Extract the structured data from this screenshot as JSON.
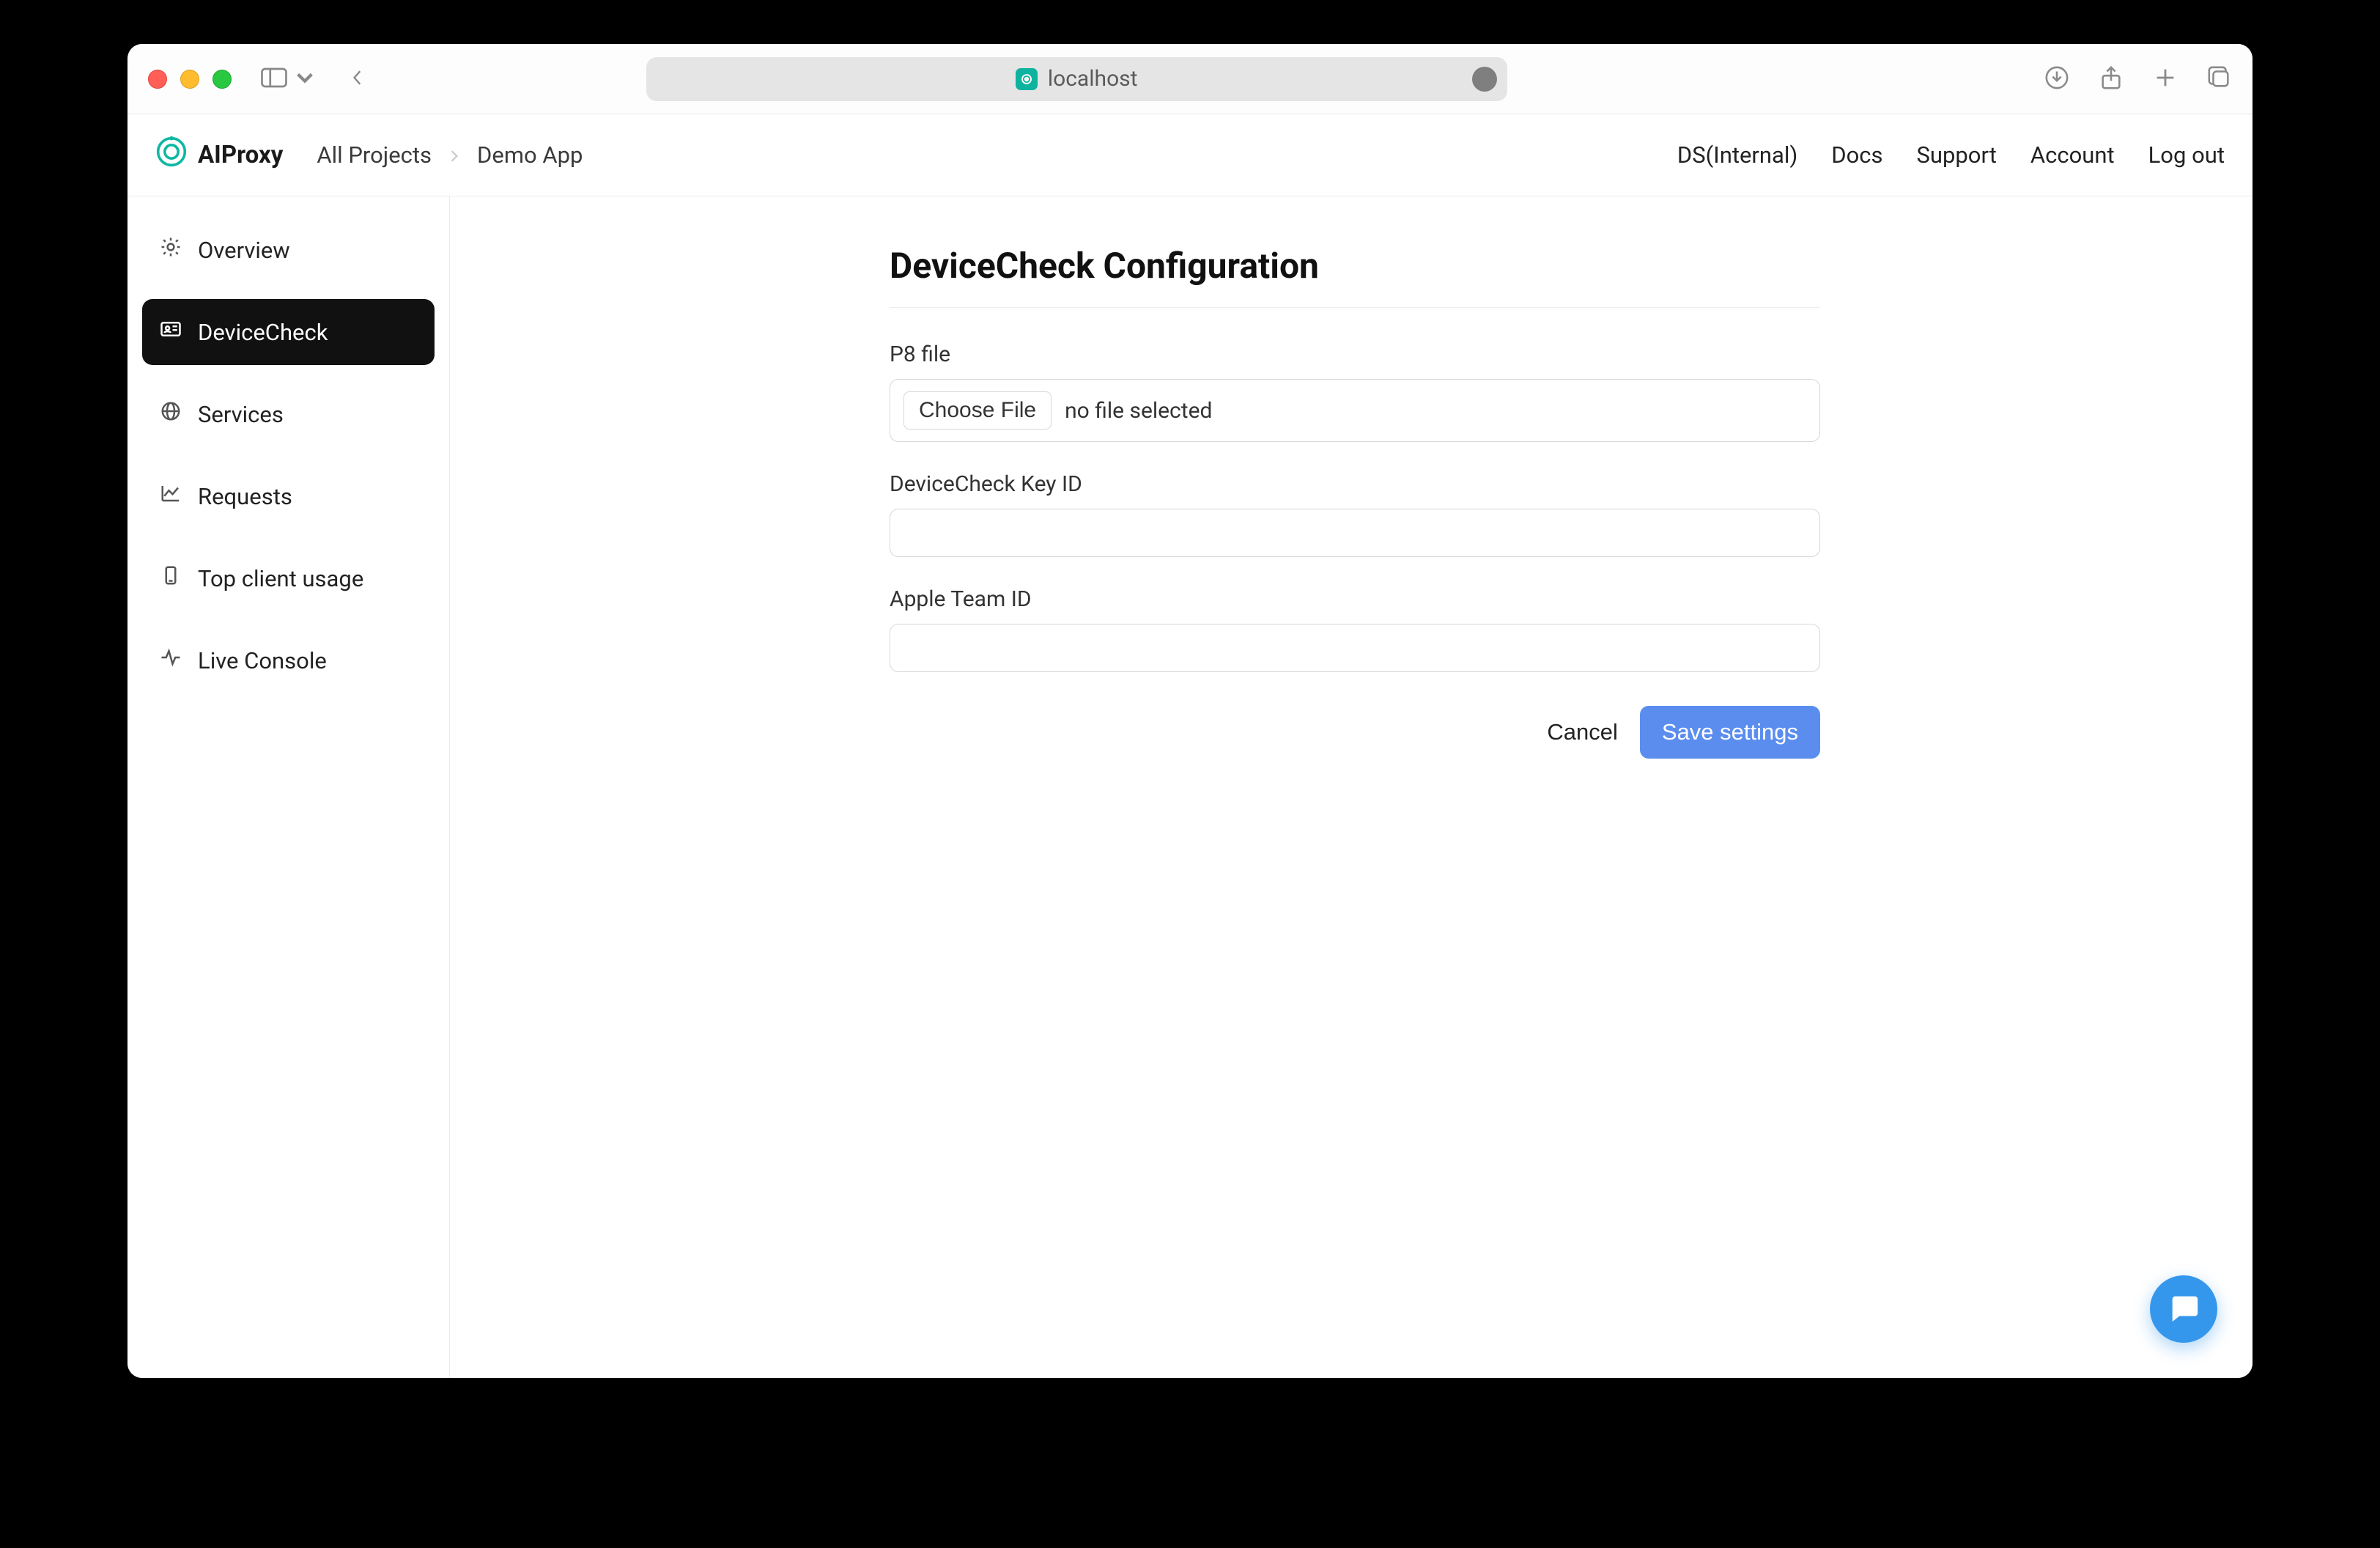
{
  "browser": {
    "url_text": "localhost"
  },
  "app": {
    "brand_name": "AIProxy",
    "breadcrumb": {
      "root": "All Projects",
      "current": "Demo App"
    },
    "nav": {
      "ds_internal": "DS(Internal)",
      "docs": "Docs",
      "support": "Support",
      "account": "Account",
      "logout": "Log out"
    }
  },
  "sidebar": {
    "items": [
      {
        "label": "Overview"
      },
      {
        "label": "DeviceCheck"
      },
      {
        "label": "Services"
      },
      {
        "label": "Requests"
      },
      {
        "label": "Top client usage"
      },
      {
        "label": "Live Console"
      }
    ]
  },
  "page": {
    "title": "DeviceCheck Configuration",
    "fields": {
      "p8_label": "P8 file",
      "choose_file": "Choose File",
      "no_file": "no file selected",
      "key_id_label": "DeviceCheck Key ID",
      "key_id_value": "",
      "team_id_label": "Apple Team ID",
      "team_id_value": ""
    },
    "actions": {
      "cancel": "Cancel",
      "save": "Save settings"
    }
  }
}
